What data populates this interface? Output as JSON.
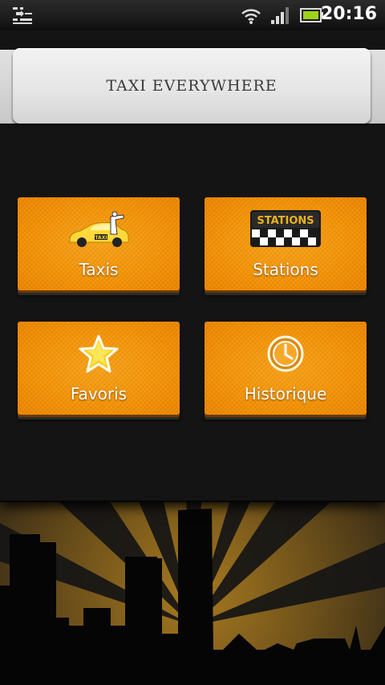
{
  "status_bar": {
    "time": "20:16",
    "icons": [
      "notification-list-icon",
      "wifi-icon",
      "signal-icon",
      "battery-icon"
    ]
  },
  "header": {
    "title": "TAXI EVERYWHERE"
  },
  "menu": {
    "tiles": [
      {
        "label": "Taxis",
        "icon": "taxi-car-icon"
      },
      {
        "label": "Stations",
        "icon": "stations-sign-icon",
        "icon_text": "STATIONS"
      },
      {
        "label": "Favoris",
        "icon": "star-icon"
      },
      {
        "label": "Historique",
        "icon": "clock-icon"
      }
    ]
  },
  "colors": {
    "tile_orange": "#f69406",
    "panel_background": "#141414",
    "title_card": "#e6e6e6",
    "skyline_glow": "#8a6418"
  }
}
